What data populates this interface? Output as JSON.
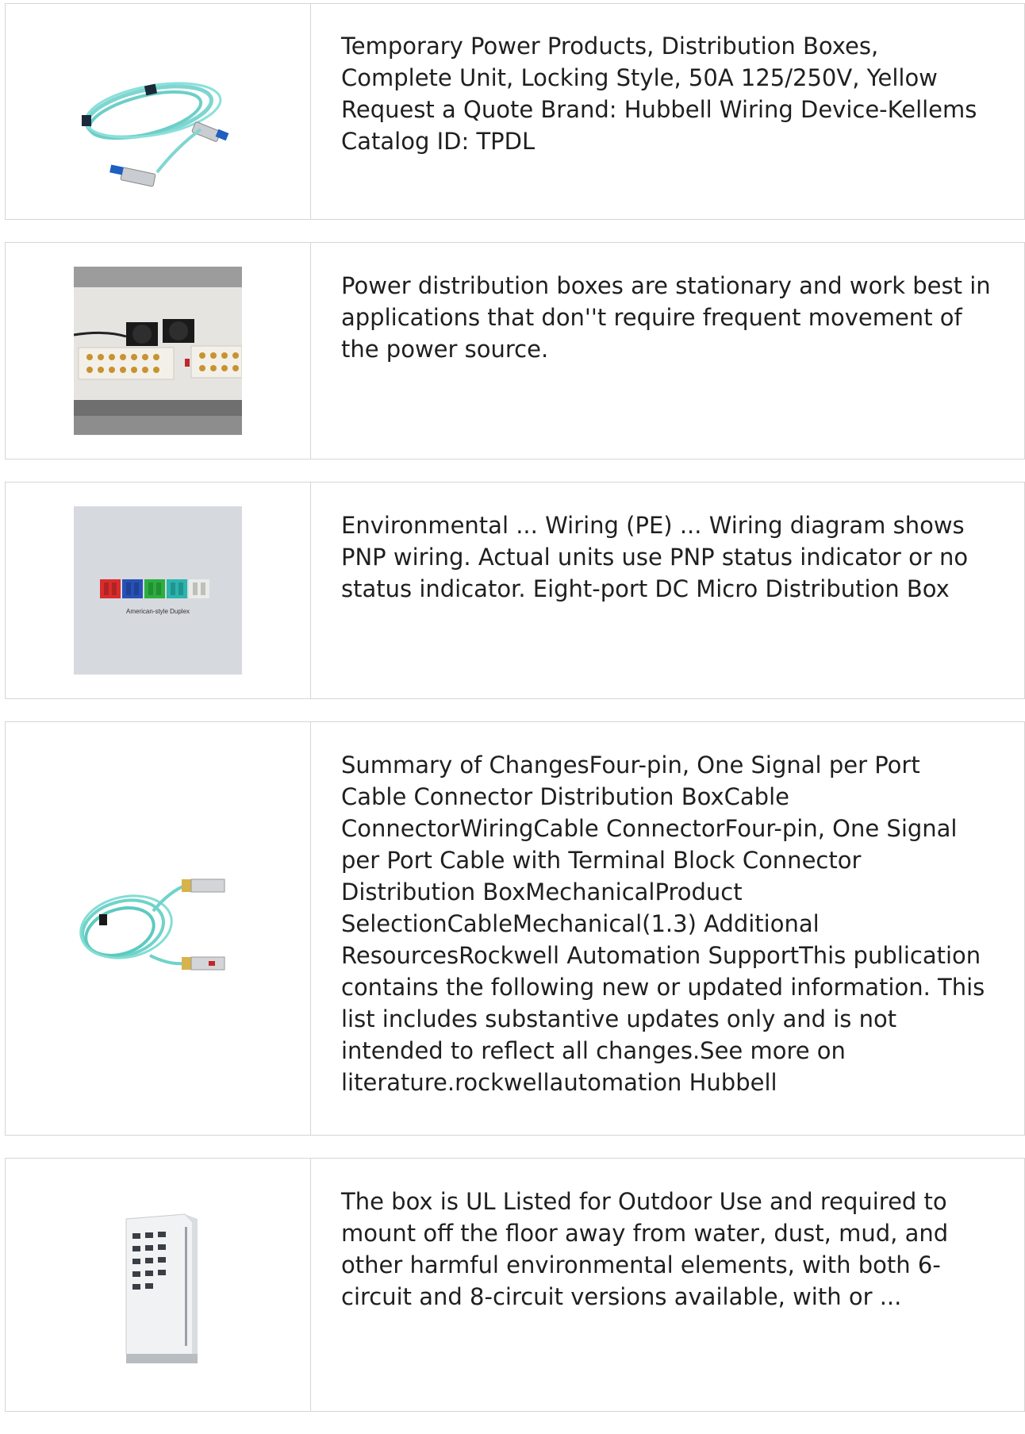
{
  "results": [
    {
      "image": "fiber-optic-cable-image",
      "text": "Temporary Power Products, Distribution Boxes, Complete Unit, Locking Style, 50A 125/250V, Yellow Request a Quote Brand: Hubbell Wiring Device-Kellems Catalog ID: TPDL"
    },
    {
      "image": "distribution-box-interior-image",
      "text": "Power distribution boxes are stationary and work best in applications that don''t require frequent movement of the power source."
    },
    {
      "image": "duplex-adapters-image",
      "caption": "American-style Duplex",
      "text": "Environmental ... Wiring (PE) ... Wiring diagram shows PNP wiring. Actual units use PNP status indicator or no status indicator. Eight-port DC Micro Distribution Box"
    },
    {
      "image": "aoc-cable-image",
      "text": "Summary of ChangesFour-pin, One Signal per Port Cable Connector Distribution BoxCable ConnectorWiringCable ConnectorFour-pin, One Signal per Port Cable with Terminal Block Connector Distribution BoxMechanicalProduct SelectionCableMechanical(1.3) Additional ResourcesRockwell Automation SupportThis publication contains the following new or updated information. This list includes substantive updates only and is not intended to reflect all changes.See more on literature.rockwellautomation Hubbell"
    },
    {
      "image": "outdoor-cabinet-image",
      "text": "The box is UL Listed for Outdoor Use and required to mount off the floor away from water, dust, mud, and other harmful environmental elements, with both 6-circuit and 8-circuit versions available, with or ..."
    }
  ]
}
